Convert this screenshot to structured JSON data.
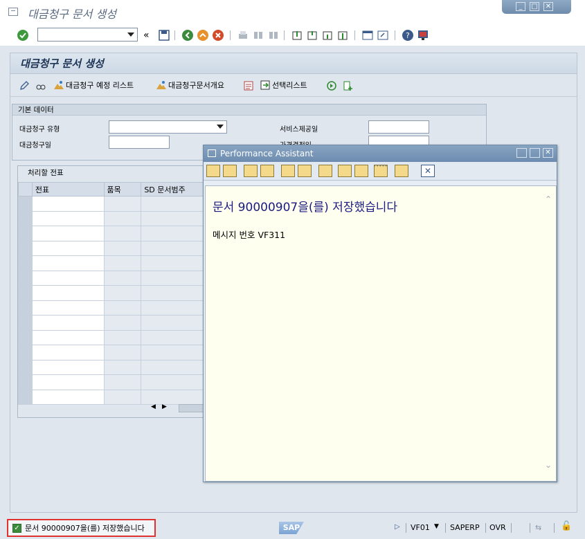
{
  "window": {
    "title": "대금청구 문서 생성",
    "controls": [
      "minimize",
      "maximize",
      "close"
    ]
  },
  "toolbar": {
    "command_field_value": "",
    "icons": [
      "enter-check",
      "back",
      "exit",
      "cancel",
      "print",
      "find",
      "find-next",
      "first-page",
      "prev-page",
      "next-page",
      "last-page",
      "new-session",
      "shortcut",
      "help",
      "customize-layout"
    ]
  },
  "page": {
    "title": "대금청구 문서 생성",
    "app_toolbar": {
      "billing_due_list": "대금청구 예정 리스트",
      "billing_doc_overview": "대금청구문서개요",
      "selection_list": "선택리스트"
    }
  },
  "basic_data": {
    "header": "기본 데이터",
    "billing_type_label": "대금청구 유형",
    "billing_type_value": "",
    "billing_date_label": "대금청구일",
    "billing_date_value": "",
    "service_date_label": "서비스제공일",
    "service_date_value": "",
    "pricing_date_label": "가격결정일",
    "pricing_date_value": ""
  },
  "docs_table": {
    "header": "처리할 전표",
    "columns": [
      "전표",
      "품목",
      "SD 문서범주"
    ],
    "row_count": 14
  },
  "performance_assistant": {
    "title": "Performance Assistant",
    "message": "문서 90000907을(를) 저장했습니다",
    "message_number_label": "메시지 번호 VF311"
  },
  "statusbar": {
    "message": "문서 90000907을(를) 저장했습니다",
    "sap_logo": "SAP",
    "transaction": "VF01",
    "system": "SAPERP",
    "mode": "OVR"
  },
  "colors": {
    "accent": "#1a1a80",
    "status_highlight": "#e03030",
    "success": "#3c8a3c"
  }
}
